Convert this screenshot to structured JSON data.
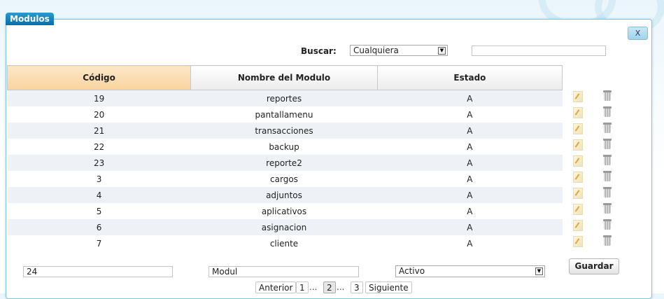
{
  "window": {
    "title": "Modulos",
    "close_label": "X"
  },
  "search": {
    "label": "Buscar:",
    "filter_value": "Cualquiera",
    "query_value": ""
  },
  "table": {
    "columns": [
      "Código",
      "Nombre del Modulo",
      "Estado"
    ],
    "rows": [
      {
        "codigo": "19",
        "nombre": "reportes",
        "estado": "A"
      },
      {
        "codigo": "20",
        "nombre": "pantallamenu",
        "estado": "A"
      },
      {
        "codigo": "21",
        "nombre": "transacciones",
        "estado": "A"
      },
      {
        "codigo": "22",
        "nombre": "backup",
        "estado": "A"
      },
      {
        "codigo": "23",
        "nombre": "reporte2",
        "estado": "A"
      },
      {
        "codigo": "3",
        "nombre": "cargos",
        "estado": "A"
      },
      {
        "codigo": "4",
        "nombre": "adjuntos",
        "estado": "A"
      },
      {
        "codigo": "5",
        "nombre": "aplicativos",
        "estado": "A"
      },
      {
        "codigo": "6",
        "nombre": "asignacion",
        "estado": "A"
      },
      {
        "codigo": "7",
        "nombre": "cliente",
        "estado": "A"
      }
    ],
    "row_actions": {
      "edit_icon": "edit-icon",
      "delete_icon": "trash-icon"
    }
  },
  "form": {
    "codigo_value": "24",
    "nombre_value": "Modul",
    "estado_value": "Activo",
    "save_label": "Guardar"
  },
  "pagination": {
    "prev_label": "Anterior",
    "pages": [
      "1",
      "2",
      "3"
    ],
    "current_page": "2",
    "ellipsis": "...",
    "next_label": "Siguiente"
  }
}
